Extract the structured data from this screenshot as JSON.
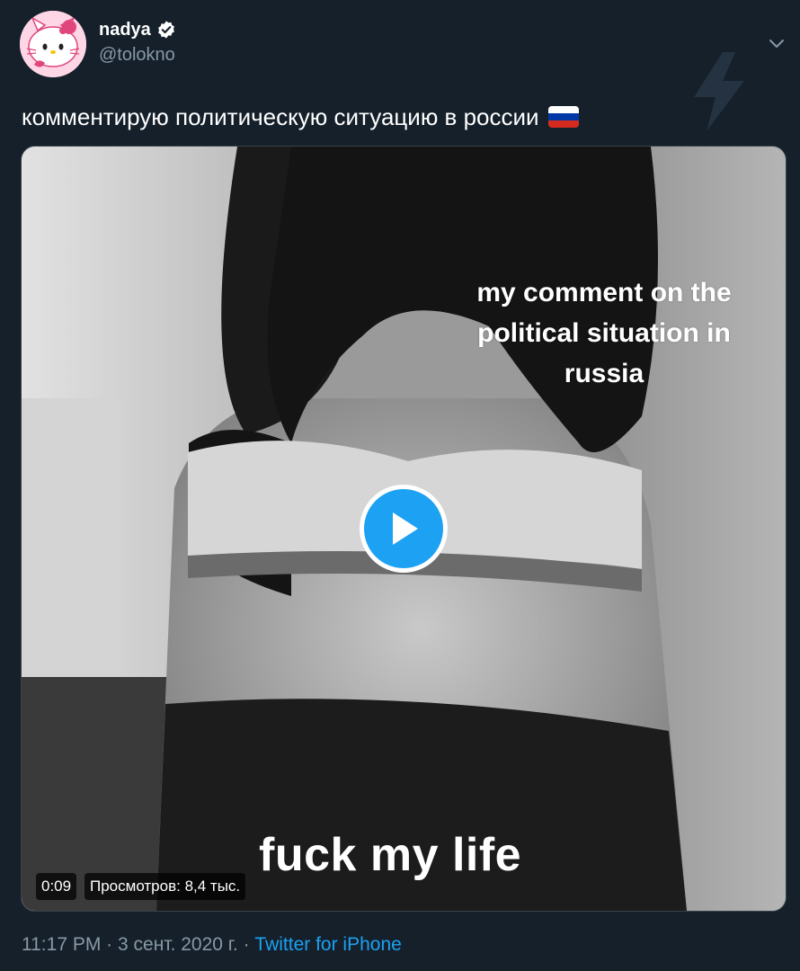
{
  "tweet": {
    "display_name": "nadya",
    "handle": "@tolokno",
    "verified": true,
    "text": "комментирую политическую ситуацию в россии",
    "flag": [
      "#ffffff",
      "#0039a6",
      "#d52b1e"
    ]
  },
  "media": {
    "overlay_top": [
      "my comment on the",
      "political situation in",
      "russia"
    ],
    "overlay_bottom": "fuck my life",
    "duration": "0:09",
    "views": "Просмотров: 8,4 тыс."
  },
  "footer": {
    "time": "11:17 PM",
    "separator": " · ",
    "date": "3 сент. 2020 г.",
    "source": "Twitter for iPhone"
  },
  "colors": {
    "background": "#15202b",
    "accent": "#1da1f2",
    "secondary_text": "#8899a6"
  },
  "icons": [
    "verified-icon",
    "chevron-down-icon",
    "lightning-icon",
    "play-icon",
    "hello-kitty-avatar"
  ]
}
